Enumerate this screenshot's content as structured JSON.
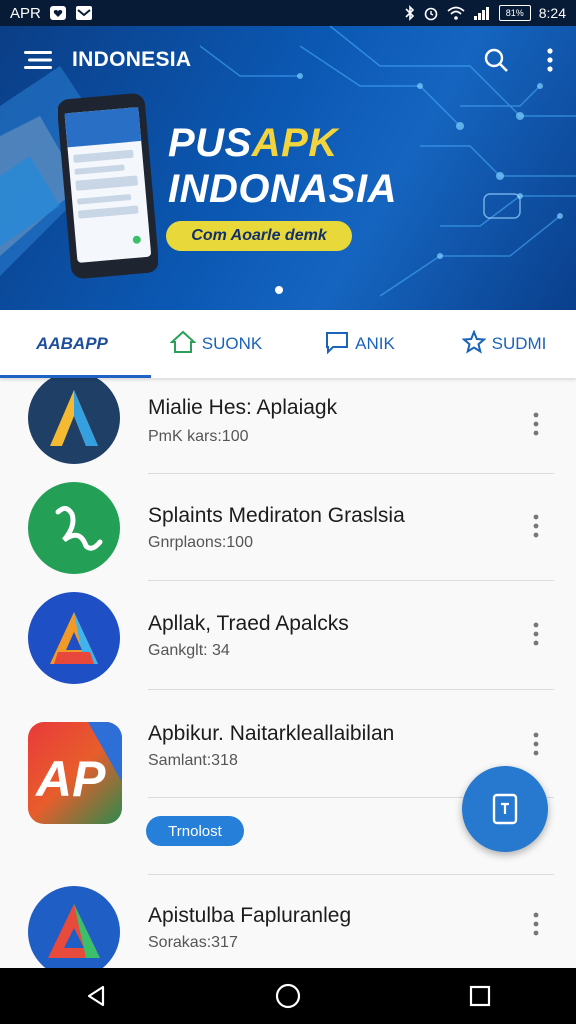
{
  "status_bar": {
    "carrier": "APR",
    "time": "8:24",
    "battery_label": "81%"
  },
  "toolbar": {
    "title": "INDONESIA"
  },
  "hero": {
    "title_white": "PUS",
    "title_accent": "APK",
    "title_line2": "INDONASIA",
    "pill_text": "Com Aoarle demk"
  },
  "tabs": [
    {
      "label": "AABAPP",
      "icon": "app-logo-icon",
      "active": true
    },
    {
      "label": "SUONK",
      "icon": "home-icon",
      "active": false
    },
    {
      "label": "ANIK",
      "icon": "chat-icon",
      "active": false
    },
    {
      "label": "SUDMI",
      "icon": "star-icon",
      "active": false
    }
  ],
  "apps": [
    {
      "name": "Mialie Hes: Aplaiagk",
      "sub": "PmK kars:100",
      "icon": "app-a-dark-icon"
    },
    {
      "name": "Splaints Mediraton Graslsia",
      "sub": "Gnrplaons:100",
      "icon": "app-green-leaf-icon"
    },
    {
      "name": "Apllak, Traed Apalcks",
      "sub": "Gankglt: 34",
      "icon": "app-a-blue-icon"
    },
    {
      "name": "Apbikur. Naitarkleallaibilan",
      "sub": "Samlant:318",
      "icon": "app-ap-icon",
      "chip": "Trnolost"
    },
    {
      "name": "Apistulba Fapluranleg",
      "sub": "Sorakas:317",
      "icon": "app-a-triangle-icon"
    }
  ],
  "colors": {
    "brand": "#0b58b3",
    "accent": "#f3d43d",
    "fab": "#2778cf"
  }
}
